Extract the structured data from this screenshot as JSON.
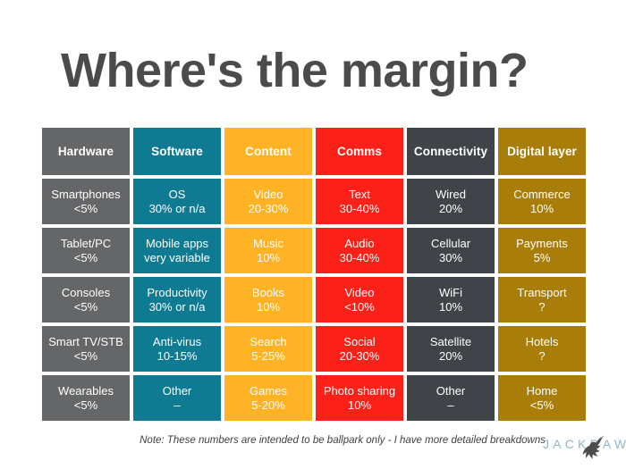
{
  "slide": {
    "title": "Where's the margin?",
    "title_color": "#4b4b4d",
    "background": "#ffffff",
    "footnote": "Note: These numbers are intended to be ballpark only - I have more detailed breakdowns"
  },
  "logo": {
    "text": "JACKDAW",
    "text_color": "#93b4c6",
    "bird_color": "#4c4c4e",
    "bird_icon": "jackdaw-bird-icon"
  },
  "matrix": {
    "columns": [
      {
        "header": "Hardware",
        "header_color": "#656668",
        "cell_color": "#656668",
        "cells": [
          {
            "line1": "Smartphones",
            "line2": "<5%"
          },
          {
            "line1": "Tablet/PC",
            "line2": "<5%"
          },
          {
            "line1": "Consoles",
            "line2": "<5%"
          },
          {
            "line1": "Smart TV/STB",
            "line2": "<5%"
          },
          {
            "line1": "Wearables",
            "line2": "<5%"
          }
        ]
      },
      {
        "header": "Software",
        "header_color": "#0e7b93",
        "cell_color": "#0e7b93",
        "cells": [
          {
            "line1": "OS",
            "line2": "30% or n/a"
          },
          {
            "line1": "Mobile apps",
            "line2": "very variable"
          },
          {
            "line1": "Productivity",
            "line2": "30% or n/a"
          },
          {
            "line1": "Anti-virus",
            "line2": "10-15%"
          },
          {
            "line1": "Other",
            "line2": "–"
          }
        ]
      },
      {
        "header": "Content",
        "header_color": "#ffb224",
        "cell_color": "#ffb224",
        "cells": [
          {
            "line1": "Video",
            "line2": "20-30%"
          },
          {
            "line1": "Music",
            "line2": "10%"
          },
          {
            "line1": "Books",
            "line2": "10%"
          },
          {
            "line1": "Search",
            "line2": "5-25%"
          },
          {
            "line1": "Games",
            "line2": "5-20%"
          }
        ]
      },
      {
        "header": "Comms",
        "header_color": "#fb2018",
        "cell_color": "#fb2018",
        "cells": [
          {
            "line1": "Text",
            "line2": "30-40%"
          },
          {
            "line1": "Audio",
            "line2": "30-40%"
          },
          {
            "line1": "Video",
            "line2": "<10%"
          },
          {
            "line1": "Social",
            "line2": "20-30%"
          },
          {
            "line1": "Photo sharing",
            "line2": "10%"
          }
        ]
      },
      {
        "header": "Connectivity",
        "header_color": "#404448",
        "cell_color": "#404448",
        "cells": [
          {
            "line1": "Wired",
            "line2": "20%"
          },
          {
            "line1": "Cellular",
            "line2": "30%"
          },
          {
            "line1": "WiFi",
            "line2": "10%"
          },
          {
            "line1": "Satellite",
            "line2": "20%"
          },
          {
            "line1": "Other",
            "line2": "–"
          }
        ]
      },
      {
        "header": "Digital layer",
        "header_color": "#a87d09",
        "cell_color": "#a87d09",
        "cells": [
          {
            "line1": "Commerce",
            "line2": "10%"
          },
          {
            "line1": "Payments",
            "line2": "5%"
          },
          {
            "line1": "Transport",
            "line2": "?"
          },
          {
            "line1": "Hotels",
            "line2": "?"
          },
          {
            "line1": "Home",
            "line2": "<5%"
          }
        ]
      }
    ]
  }
}
